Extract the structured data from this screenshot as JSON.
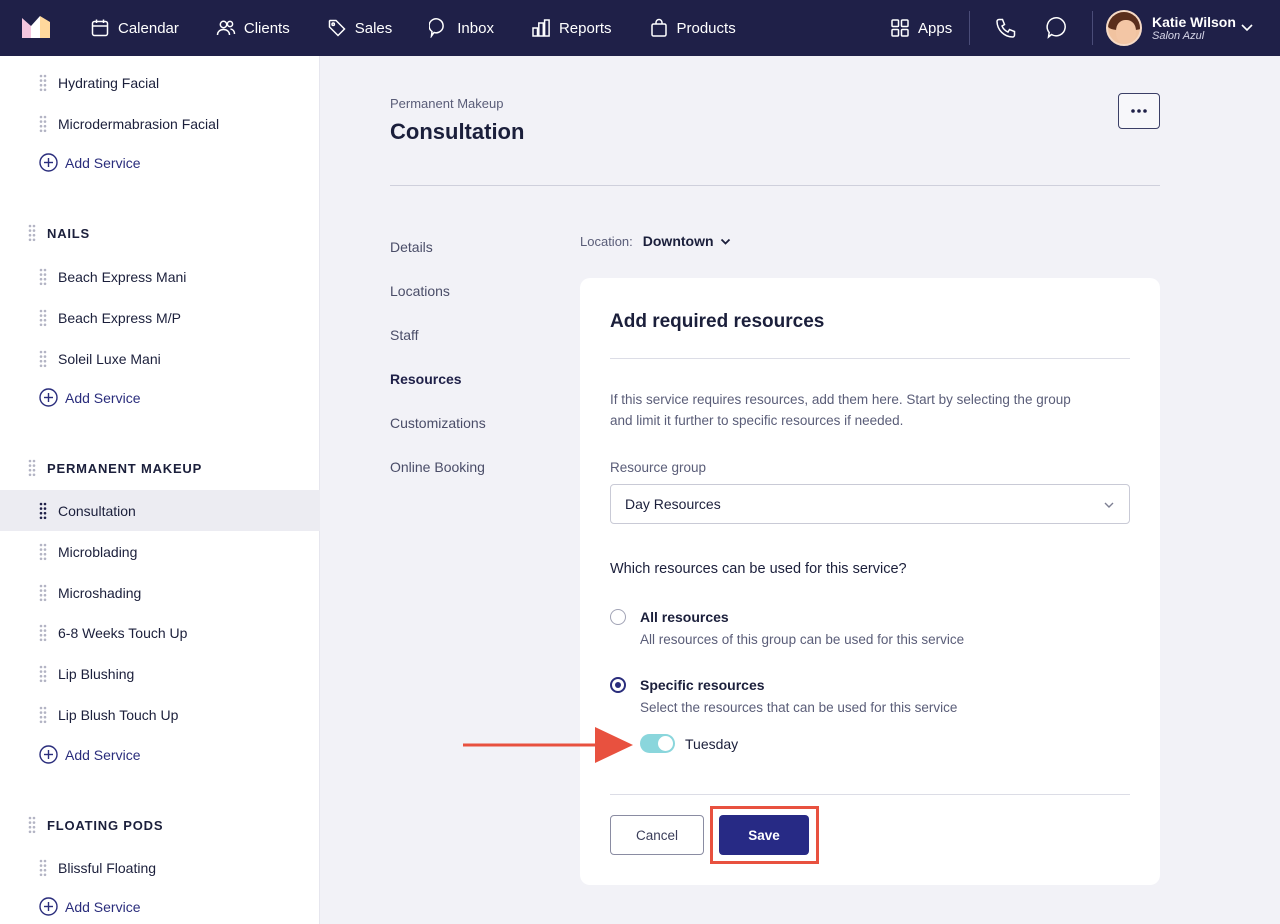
{
  "topbar": {
    "nav": [
      {
        "label": "Calendar",
        "icon": "calendar-icon"
      },
      {
        "label": "Clients",
        "icon": "users-icon"
      },
      {
        "label": "Sales",
        "icon": "tag-icon"
      },
      {
        "label": "Inbox",
        "icon": "chat-bubble-icon"
      },
      {
        "label": "Reports",
        "icon": "bar-chart-icon"
      },
      {
        "label": "Products",
        "icon": "shopping-bag-icon"
      }
    ],
    "apps_label": "Apps",
    "user": {
      "name": "Katie Wilson",
      "salon": "Salon Azul"
    }
  },
  "sidebar": {
    "facial_items": [
      "Hydrating Facial",
      "Microdermabrasion Facial"
    ],
    "add_service_label": "Add Service",
    "nails": {
      "title": "NAILS",
      "items": [
        "Beach Express Mani",
        "Beach Express M/P",
        "Soleil Luxe Mani"
      ]
    },
    "permanent_makeup": {
      "title": "PERMANENT MAKEUP",
      "items": [
        "Consultation",
        "Microblading",
        "Microshading",
        "6-8 Weeks Touch Up",
        "Lip Blushing",
        "Lip Blush Touch Up"
      ],
      "active_item": "Consultation"
    },
    "floating_pods": {
      "title": "FLOATING PODS",
      "items": [
        "Blissful Floating"
      ]
    }
  },
  "main": {
    "breadcrumb": "Permanent Makeup",
    "title": "Consultation",
    "subnav": [
      "Details",
      "Locations",
      "Staff",
      "Resources",
      "Customizations",
      "Online Booking"
    ],
    "subnav_active": "Resources",
    "location_label": "Location:",
    "location_value": "Downtown"
  },
  "card": {
    "title": "Add required resources",
    "description": "If this service requires resources, add them here. Start by selecting the group and limit it further to specific resources if needed.",
    "resource_group_label": "Resource group",
    "resource_group_value": "Day Resources",
    "question": "Which resources can be used for this service?",
    "options": [
      {
        "title": "All resources",
        "subtitle": "All resources of this group can be used for this service",
        "checked": false
      },
      {
        "title": "Specific resources",
        "subtitle": "Select the resources that can be used for this service",
        "checked": true
      }
    ],
    "toggle_label": "Tuesday",
    "toggle_on": true,
    "cancel_label": "Cancel",
    "save_label": "Save"
  },
  "colors": {
    "topbar": "#1f2048",
    "primary": "#272a85",
    "toggle": "#8ad6dc",
    "annotation": "#e8513f"
  }
}
